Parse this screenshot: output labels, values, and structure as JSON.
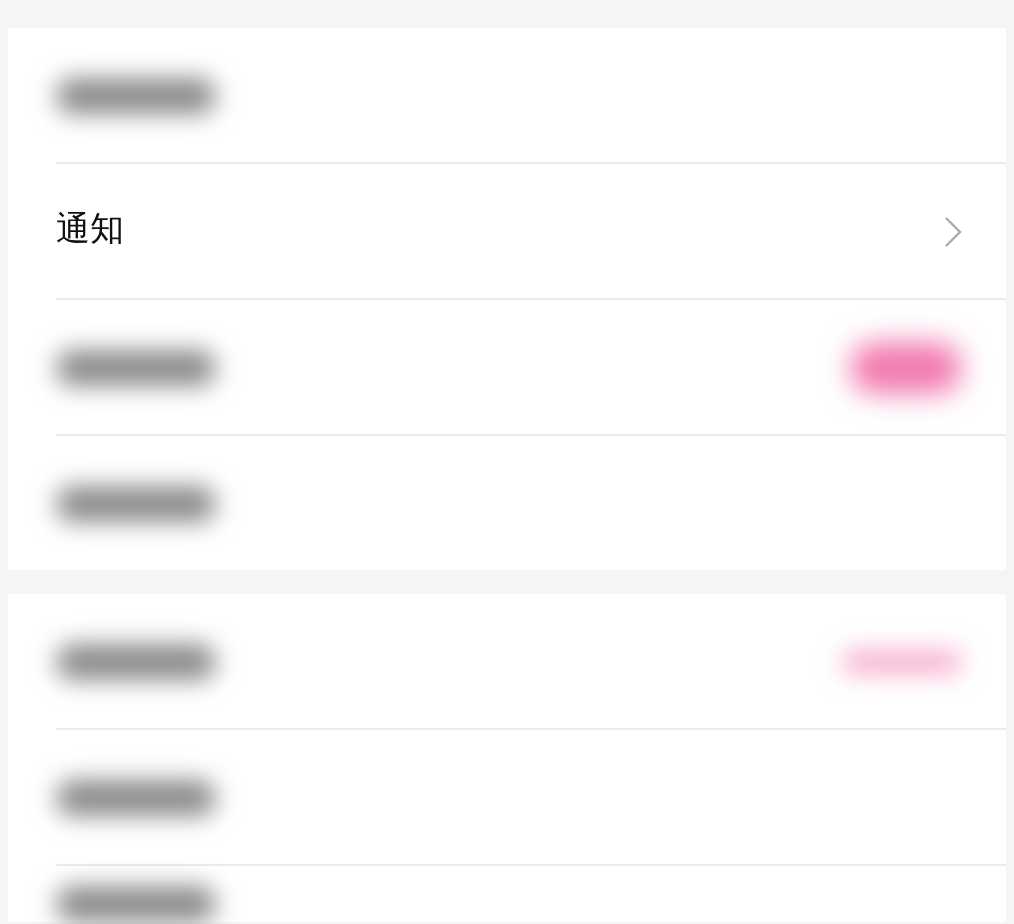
{
  "sections": [
    {
      "rows": [
        {
          "kind": "blurred"
        },
        {
          "kind": "nav",
          "label": "通知"
        },
        {
          "kind": "switch"
        },
        {
          "kind": "blurred"
        }
      ]
    },
    {
      "rows": [
        {
          "kind": "value"
        },
        {
          "kind": "blurred"
        },
        {
          "kind": "blurred"
        }
      ]
    }
  ]
}
